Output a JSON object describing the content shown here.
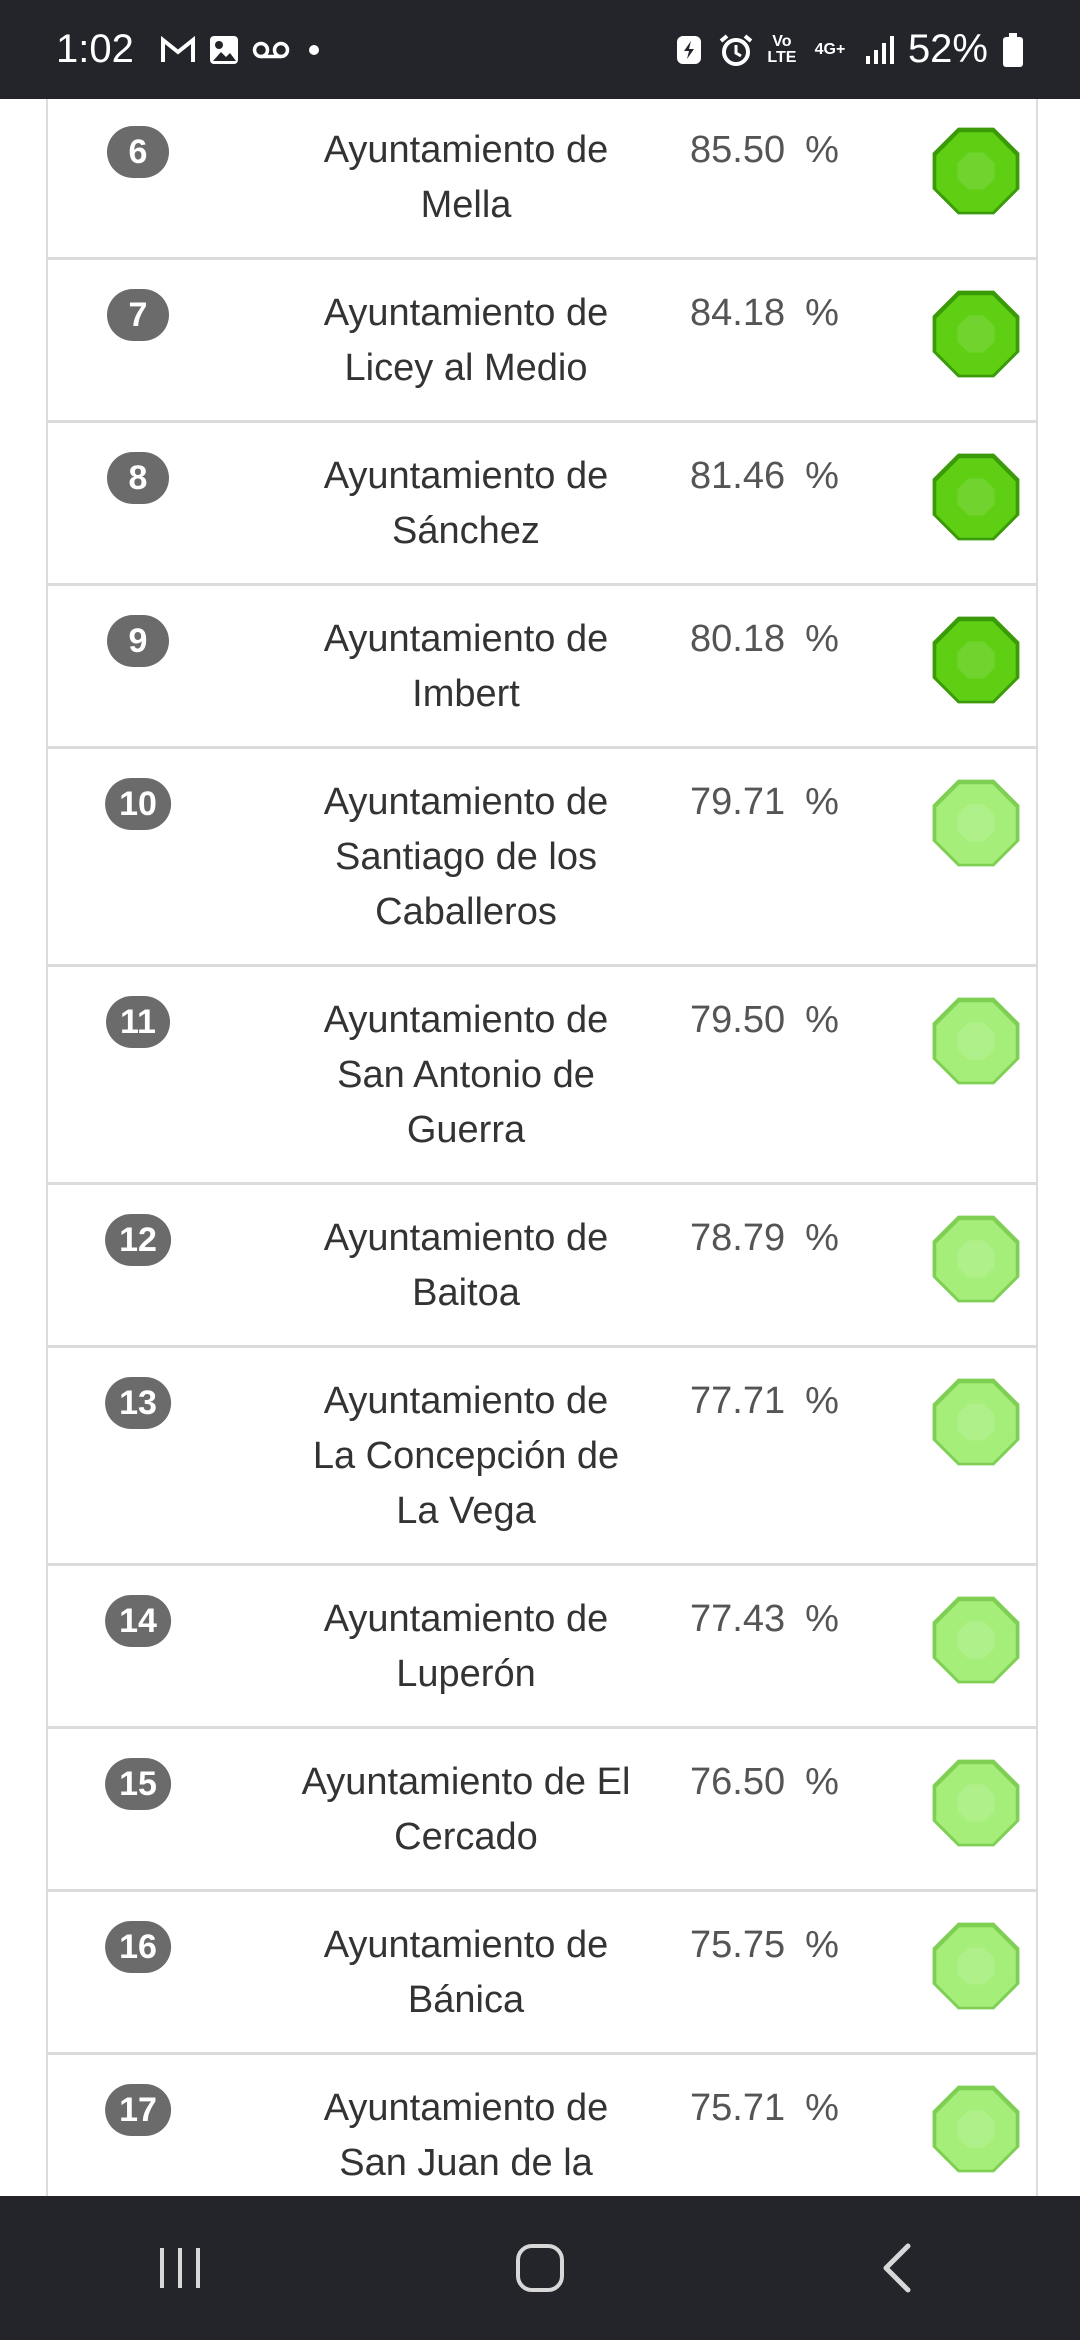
{
  "status_bar": {
    "time": "1:02",
    "battery": "52%",
    "network": "4G+",
    "volte": "Vo LTE"
  },
  "colors": {
    "high": "#5ecf12",
    "medium": "#a6ee7a"
  },
  "rows": [
    {
      "rank": "6",
      "name": "Ayuntamiento de Mella",
      "score": "85.50",
      "unit": "%",
      "level": "high"
    },
    {
      "rank": "7",
      "name": "Ayuntamiento de Licey al Medio",
      "score": "84.18",
      "unit": "%",
      "level": "high"
    },
    {
      "rank": "8",
      "name": "Ayuntamiento de Sánchez",
      "score": "81.46",
      "unit": "%",
      "level": "high"
    },
    {
      "rank": "9",
      "name": "Ayuntamiento de Imbert",
      "score": "80.18",
      "unit": "%",
      "level": "high"
    },
    {
      "rank": "10",
      "name": "Ayuntamiento de Santiago de los Caballeros",
      "score": "79.71",
      "unit": "%",
      "level": "medium"
    },
    {
      "rank": "11",
      "name": "Ayuntamiento de San Antonio de Guerra",
      "score": "79.50",
      "unit": "%",
      "level": "medium"
    },
    {
      "rank": "12",
      "name": "Ayuntamiento de Baitoa",
      "score": "78.79",
      "unit": "%",
      "level": "medium"
    },
    {
      "rank": "13",
      "name": "Ayuntamiento de La Concepción de La Vega",
      "score": "77.71",
      "unit": "%",
      "level": "medium"
    },
    {
      "rank": "14",
      "name": "Ayuntamiento de Luperón",
      "score": "77.43",
      "unit": "%",
      "level": "medium"
    },
    {
      "rank": "15",
      "name": "Ayuntamiento de El Cercado",
      "score": "76.50",
      "unit": "%",
      "level": "medium"
    },
    {
      "rank": "16",
      "name": "Ayuntamiento de Bánica",
      "score": "75.75",
      "unit": "%",
      "level": "medium"
    },
    {
      "rank": "17",
      "name": "Ayuntamiento de San Juan de la",
      "score": "75.71",
      "unit": "%",
      "level": "medium"
    }
  ]
}
